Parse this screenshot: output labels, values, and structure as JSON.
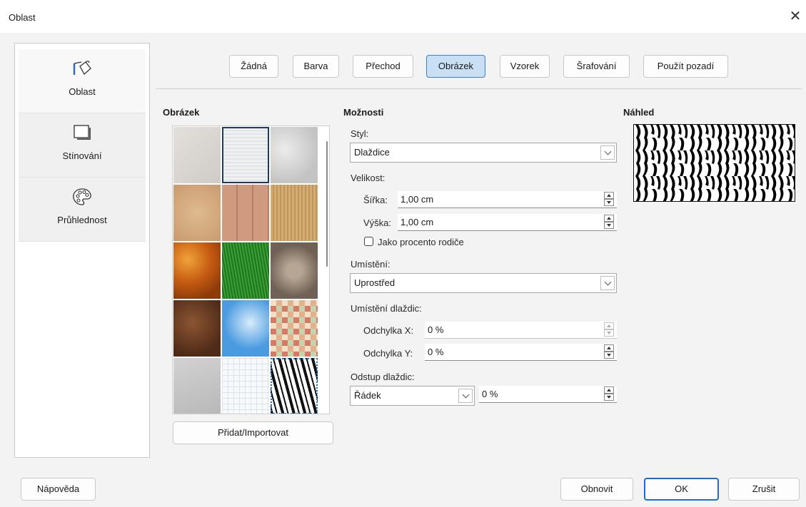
{
  "window": {
    "title": "Oblast",
    "close_glyph": "✕"
  },
  "nav": {
    "items": [
      {
        "label": "Oblast",
        "icon": "paint-bucket-icon",
        "active": true
      },
      {
        "label": "Stínování",
        "icon": "shadow-icon",
        "active": false
      },
      {
        "label": "Průhlednost",
        "icon": "palette-icon",
        "active": false
      }
    ]
  },
  "fill_types": [
    {
      "label": "Žádná",
      "selected": false
    },
    {
      "label": "Barva",
      "selected": false
    },
    {
      "label": "Přechod",
      "selected": false
    },
    {
      "label": "Obrázek",
      "selected": true
    },
    {
      "label": "Vzorek",
      "selected": false
    },
    {
      "label": "Šrafování",
      "selected": false
    },
    {
      "label": "Použít pozadí",
      "selected": false
    }
  ],
  "gallery": {
    "title": "Obrázek",
    "tiles": [
      {
        "name": "painted-white",
        "color": "#d9d6d2"
      },
      {
        "name": "paper-texture",
        "color": "#eceef0",
        "selected": true
      },
      {
        "name": "paper-crumpled",
        "color": "#d4d4d4"
      },
      {
        "name": "pink-sandstone",
        "color": "#d8b38a"
      },
      {
        "name": "wooden-board",
        "color": "#c9957a"
      },
      {
        "name": "color-stripes",
        "color": "#caa46b"
      },
      {
        "name": "maple-leaves",
        "color": "#d97a1c"
      },
      {
        "name": "lawn",
        "color": "#2f8f2a"
      },
      {
        "name": "pebble-light",
        "color": "#958474"
      },
      {
        "name": "coffee-beans",
        "color": "#6e4026"
      },
      {
        "name": "sky",
        "color": "#5da8e6"
      },
      {
        "name": "mosaic",
        "color": "#d8c3a8"
      },
      {
        "name": "concrete",
        "color": "#c7c7c7"
      },
      {
        "name": "graph-paper",
        "color": "#f5f7fa"
      },
      {
        "name": "zebra",
        "color": "#222222",
        "focused": true
      }
    ],
    "add_button": "Přidat/Importovat"
  },
  "options": {
    "title": "Možnosti",
    "style_label": "Styl:",
    "style_value": "Dlaždice",
    "size_label": "Velikost:",
    "width_label": "Šířka:",
    "width_value": "1,00 cm",
    "height_label": "Výška:",
    "height_value": "1,00 cm",
    "relative_checkbox_label": "Jako procento rodiče",
    "relative_checked": false,
    "position_label": "Umístění:",
    "position_value": "Uprostřed",
    "tile_position_label": "Umístění dlaždic:",
    "offset_x_label": "Odchylka X:",
    "offset_x_value": "0 %",
    "offset_y_label": "Odchylka Y:",
    "offset_y_value": "0 %",
    "tile_spacing_label": "Odstup dlaždic:",
    "tile_spacing_type": "Řádek",
    "tile_spacing_value": "0 %"
  },
  "preview": {
    "title": "Náhled",
    "pattern": "zebra"
  },
  "footer": {
    "help": "Nápověda",
    "reset": "Obnovit",
    "ok": "OK",
    "cancel": "Zrušit"
  },
  "colors": {
    "selected_button_bg": "#c9dff3",
    "selected_button_border": "#3b7fc4",
    "primary_border": "#1c6fc1"
  }
}
